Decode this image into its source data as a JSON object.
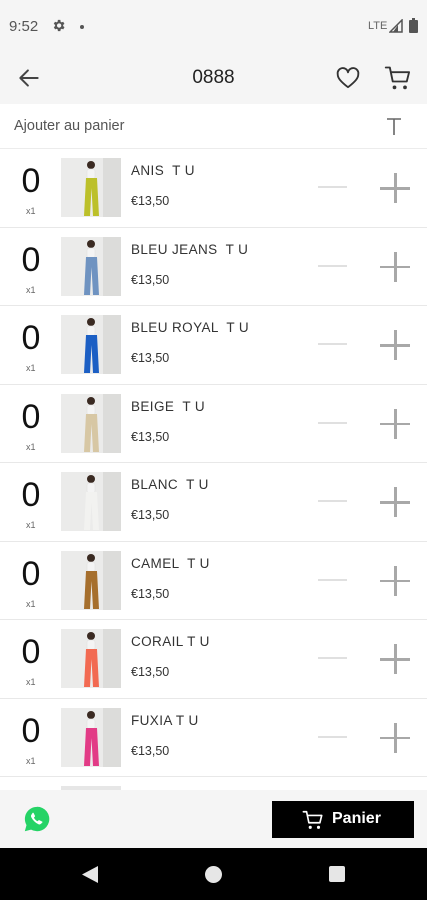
{
  "status_bar": {
    "time": "9:52",
    "network": "LTE",
    "icons": [
      "gear-icon",
      "dot-icon",
      "signal-icon",
      "battery-icon"
    ]
  },
  "header": {
    "title": "0888",
    "icons": [
      "back-arrow-icon",
      "heart-icon",
      "cart-icon"
    ]
  },
  "subheader": {
    "label": "Ajouter au panier",
    "icon": "sort-icon"
  },
  "products": [
    {
      "name": "ANIS  T U",
      "price": "€13,50",
      "quantity": "0",
      "multiplier": "x1",
      "color": "#bcc02a"
    },
    {
      "name": "BLEU JEANS  T U",
      "price": "€13,50",
      "quantity": "0",
      "multiplier": "x1",
      "color": "#6f93c1"
    },
    {
      "name": "BLEU ROYAL  T U",
      "price": "€13,50",
      "quantity": "0",
      "multiplier": "x1",
      "color": "#1c5fc4"
    },
    {
      "name": "BEIGE  T U",
      "price": "€13,50",
      "quantity": "0",
      "multiplier": "x1",
      "color": "#d7c7a4"
    },
    {
      "name": "BLANC  T U",
      "price": "€13,50",
      "quantity": "0",
      "multiplier": "x1",
      "color": "#f2f2f0"
    },
    {
      "name": "CAMEL  T U",
      "price": "€13,50",
      "quantity": "0",
      "multiplier": "x1",
      "color": "#a66f2d"
    },
    {
      "name": "CORAIL T U",
      "price": "€13,50",
      "quantity": "0",
      "multiplier": "x1",
      "color": "#f26a52"
    },
    {
      "name": "FUXIA T U",
      "price": "€13,50",
      "quantity": "0",
      "multiplier": "x1",
      "color": "#e23b86"
    }
  ],
  "bottom_bar": {
    "cart_button_label": "Panier",
    "icons": [
      "whatsapp-icon",
      "cart-icon"
    ],
    "whatsapp_color": "#25d366"
  },
  "nav_bar": {
    "icons": [
      "nav-back-icon",
      "nav-home-icon",
      "nav-recent-icon"
    ]
  }
}
